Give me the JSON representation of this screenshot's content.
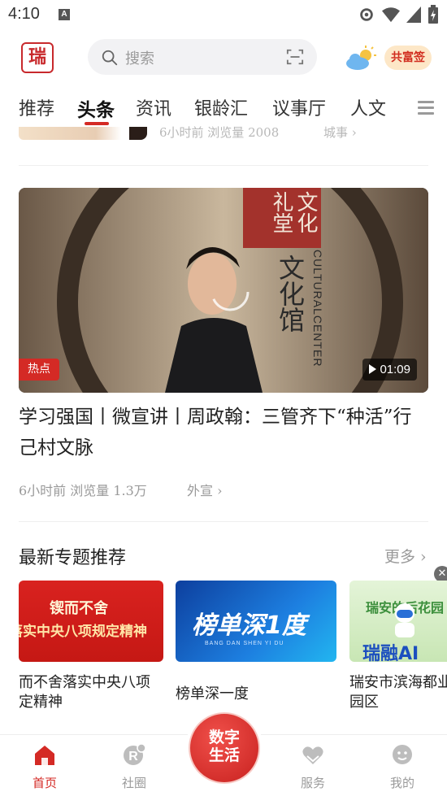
{
  "status": {
    "time": "4:10",
    "notif_letter": "A"
  },
  "header": {
    "logo_text": "瑞",
    "search_placeholder": "搜索",
    "brand_badge": "共富签"
  },
  "tabs": {
    "items": [
      "推荐",
      "头条",
      "资讯",
      "银龄汇",
      "议事厅",
      "人文"
    ],
    "active": "头条"
  },
  "prev_article": {
    "meta": "6小时前   浏览量  2008",
    "source": "城事"
  },
  "video_article": {
    "badge": "热点",
    "duration": "01:09",
    "video_text_1": "文化馆",
    "video_text_2": "CULTURALCENTER",
    "video_text_3": "文化礼堂",
    "title": "学习强国丨微宣讲丨周政翰：三管齐下“种活”行己村文脉",
    "meta": "6小时前   浏览量  1.3万",
    "source": "外宣"
  },
  "topics": {
    "title": "最新专题推荐",
    "more": "更多",
    "cards": [
      {
        "img_line1": "锲而不舍",
        "img_line2": "落实中央八项规定精神",
        "label": "而不舍落实中央八项定精神"
      },
      {
        "img_line1": "榜单深1度",
        "img_line2": "BANG DAN SHEN YI DU",
        "label": "榜单深一度"
      },
      {
        "img_line1": "瑞融AI",
        "img_line2": "瑞安的后花园",
        "label": "瑞安市滨海都业园区"
      }
    ]
  },
  "bottom_nav": {
    "items": [
      "首页",
      "社圈",
      "服务",
      "我的"
    ],
    "center_line1": "数字",
    "center_line2": "生活"
  },
  "colors": {
    "accent": "#d42a25",
    "muted": "#9a9a9a"
  }
}
